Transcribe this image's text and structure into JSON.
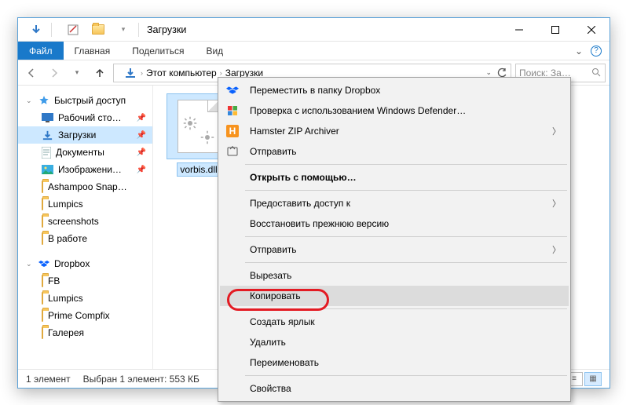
{
  "title": "Загрузки",
  "tabs": {
    "file": "Файл",
    "home": "Главная",
    "share": "Поделиться",
    "view": "Вид"
  },
  "breadcrumb": {
    "root": "Этот компьютер",
    "current": "Загрузки"
  },
  "search": {
    "placeholder": "Поиск: За…"
  },
  "nav": {
    "quick": {
      "label": "Быстрый доступ",
      "items": [
        {
          "label": "Рабочий сто…",
          "icon": "desktop",
          "pinned": true
        },
        {
          "label": "Загрузки",
          "icon": "downloads",
          "pinned": true,
          "selected": true
        },
        {
          "label": "Документы",
          "icon": "documents",
          "pinned": true
        },
        {
          "label": "Изображени…",
          "icon": "pictures",
          "pinned": true
        },
        {
          "label": "Ashampoo Snap…",
          "icon": "folder"
        },
        {
          "label": "Lumpics",
          "icon": "folder"
        },
        {
          "label": "screenshots",
          "icon": "folder"
        },
        {
          "label": "В работе",
          "icon": "folder"
        }
      ]
    },
    "dropbox": {
      "label": "Dropbox",
      "items": [
        {
          "label": "FB",
          "icon": "folder"
        },
        {
          "label": "Lumpics",
          "icon": "folder"
        },
        {
          "label": "Prime Compfix",
          "icon": "folder"
        },
        {
          "label": "Галерея",
          "icon": "folder"
        }
      ]
    }
  },
  "files": [
    {
      "name": "vorbis.dll"
    }
  ],
  "context_menu": {
    "groups": [
      [
        {
          "label": "Переместить в папку Dropbox",
          "icon": "dropbox"
        },
        {
          "label": "Проверка с использованием Windows Defender…",
          "icon": "defender"
        },
        {
          "label": "Hamster ZIP Archiver",
          "icon": "hamster",
          "submenu": true
        },
        {
          "label": "Отправить",
          "icon": "share"
        }
      ],
      [
        {
          "label": "Открыть с помощью…",
          "bold": true
        }
      ],
      [
        {
          "label": "Предоставить доступ к",
          "submenu": true
        },
        {
          "label": "Восстановить прежнюю версию"
        }
      ],
      [
        {
          "label": "Отправить",
          "submenu": true
        }
      ],
      [
        {
          "label": "Вырезать"
        },
        {
          "label": "Копировать",
          "hover": true,
          "highlight": true
        }
      ],
      [
        {
          "label": "Создать ярлык"
        },
        {
          "label": "Удалить"
        },
        {
          "label": "Переименовать"
        }
      ],
      [
        {
          "label": "Свойства"
        }
      ]
    ]
  },
  "status": {
    "count": "1 элемент",
    "selection": "Выбран 1 элемент: 553 КБ"
  }
}
